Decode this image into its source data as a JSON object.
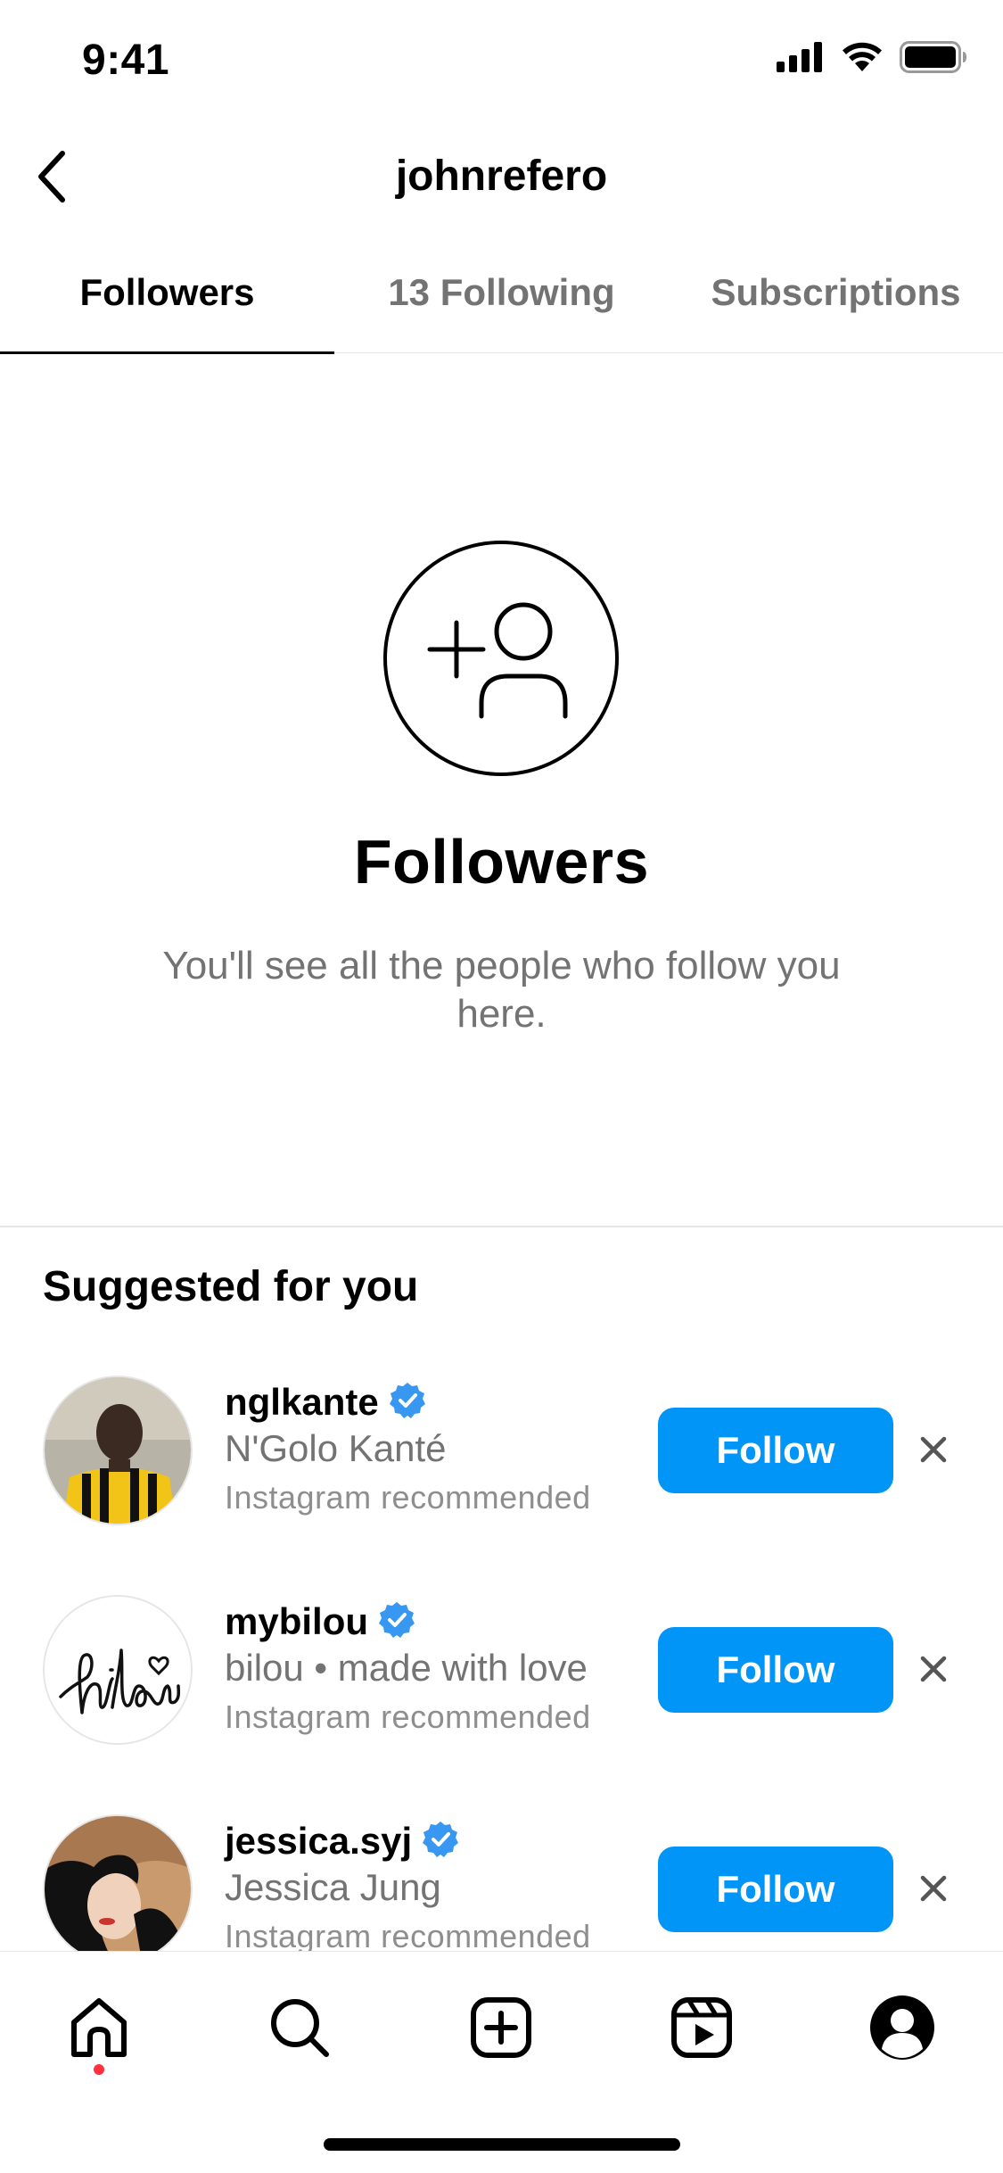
{
  "status_bar": {
    "time": "9:41"
  },
  "header": {
    "title": "johnrefero"
  },
  "tabs": [
    {
      "label": "Followers",
      "active": true
    },
    {
      "label": "13 Following",
      "active": false
    },
    {
      "label": "Subscriptions",
      "active": false
    }
  ],
  "empty_state": {
    "icon": "add-person-icon",
    "title": "Followers",
    "description": "You'll see all the people who follow you here."
  },
  "suggested": {
    "title": "Suggested for you",
    "items": [
      {
        "username": "nglkante",
        "verified": true,
        "full_name": "N'Golo Kanté",
        "reason": "Instagram recommended",
        "follow_label": "Follow"
      },
      {
        "username": "mybilou",
        "verified": true,
        "full_name": "bilou • made with love",
        "reason": "Instagram recommended",
        "follow_label": "Follow"
      },
      {
        "username": "jessica.syj",
        "verified": true,
        "full_name": "Jessica Jung",
        "reason": "Instagram recommended",
        "follow_label": "Follow"
      }
    ]
  },
  "bottom_nav": {
    "items": [
      "home-icon",
      "search-icon",
      "create-icon",
      "reels-icon",
      "profile-icon"
    ],
    "active": "home-icon"
  },
  "colors": {
    "accent": "#0095f6",
    "secondary_text": "#737373",
    "verified": "#3897f0",
    "notification_dot": "#ff3040"
  }
}
